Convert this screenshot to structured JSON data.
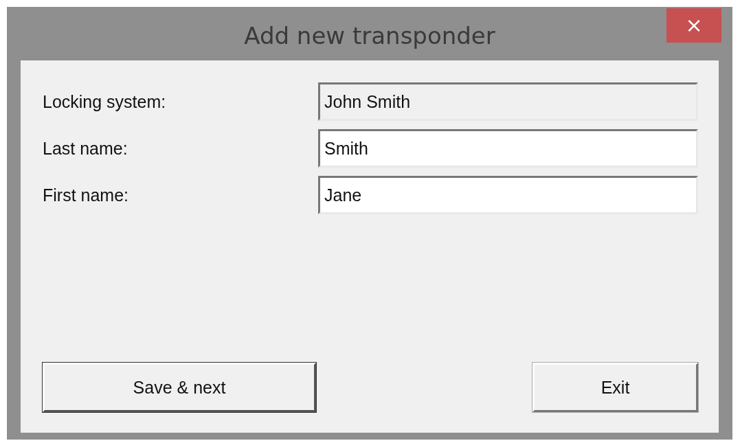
{
  "window": {
    "title": "Add new transponder",
    "close": "×"
  },
  "fields": [
    {
      "label": "Locking system:",
      "value": "John Smith",
      "disabled": true
    },
    {
      "label": "Last name:",
      "value": "Smith",
      "disabled": false
    },
    {
      "label": "First name:",
      "value": "Jane",
      "disabled": false
    }
  ],
  "buttons": [
    {
      "label": "Save & next",
      "kind": "primary"
    },
    {
      "label": "Exit",
      "kind": "normal"
    }
  ]
}
